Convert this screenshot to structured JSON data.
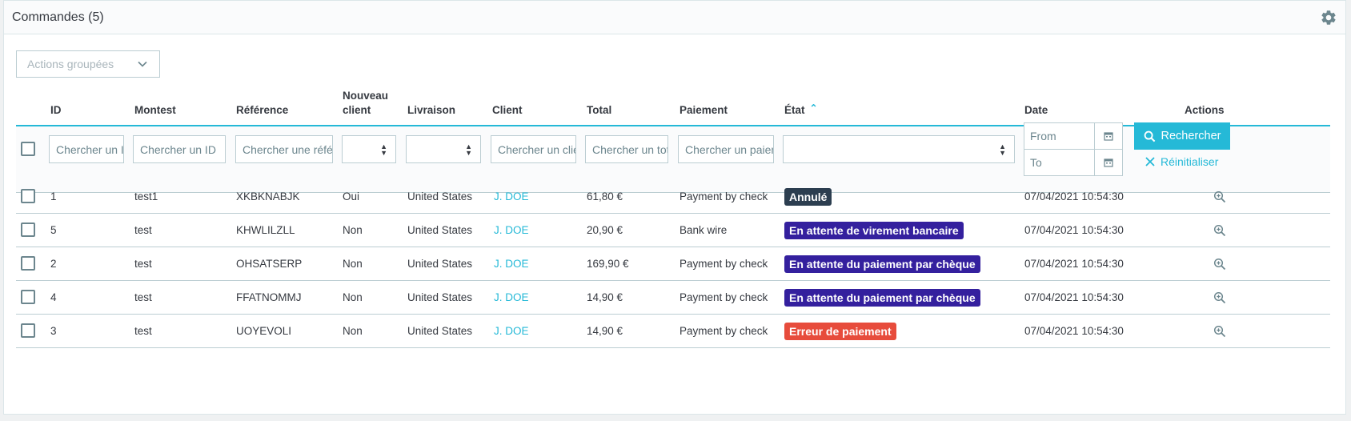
{
  "panel": {
    "title": "Commandes (5)"
  },
  "bulk_actions": {
    "label": "Actions groupées"
  },
  "columns": {
    "id": "ID",
    "montest": "Montest",
    "reference": "Référence",
    "new_client_line1": "Nouveau",
    "new_client_line2": "client",
    "delivery": "Livraison",
    "client": "Client",
    "total": "Total",
    "payment": "Paiement",
    "status": "État",
    "date": "Date",
    "actions": "Actions"
  },
  "filters": {
    "id_placeholder": "Chercher un ID",
    "montest_placeholder": "Chercher un ID",
    "reference_placeholder": "Chercher une référence",
    "client_placeholder": "Chercher un client",
    "total_placeholder": "Chercher un total",
    "payment_placeholder": "Chercher un paiement",
    "date_from": "From",
    "date_to": "To",
    "search_label": "Rechercher",
    "reset_label": "Réinitialiser"
  },
  "colors": {
    "accent": "#25b9d7",
    "status_cancelled": "#2c3e50",
    "status_awaiting": "#34209e",
    "status_error": "#e74c3c"
  },
  "rows": [
    {
      "id": "1",
      "montest": "test1",
      "reference": "XKBKNABJK",
      "new_client": "Oui",
      "delivery": "United States",
      "client": "J. DOE",
      "total": "61,80 €",
      "payment": "Payment by check",
      "status": "Annulé",
      "status_color": "#2c3e50",
      "date": "07/04/2021 10:54:30"
    },
    {
      "id": "5",
      "montest": "test",
      "reference": "KHWLILZLL",
      "new_client": "Non",
      "delivery": "United States",
      "client": "J. DOE",
      "total": "20,90 €",
      "payment": "Bank wire",
      "status": "En attente de virement bancaire",
      "status_color": "#34209e",
      "date": "07/04/2021 10:54:30"
    },
    {
      "id": "2",
      "montest": "test",
      "reference": "OHSATSERP",
      "new_client": "Non",
      "delivery": "United States",
      "client": "J. DOE",
      "total": "169,90 €",
      "payment": "Payment by check",
      "status": "En attente du paiement par chèque",
      "status_color": "#34209e",
      "date": "07/04/2021 10:54:30"
    },
    {
      "id": "4",
      "montest": "test",
      "reference": "FFATNOMMJ",
      "new_client": "Non",
      "delivery": "United States",
      "client": "J. DOE",
      "total": "14,90 €",
      "payment": "Payment by check",
      "status": "En attente du paiement par chèque",
      "status_color": "#34209e",
      "date": "07/04/2021 10:54:30"
    },
    {
      "id": "3",
      "montest": "test",
      "reference": "UOYEVOLI",
      "new_client": "Non",
      "delivery": "United States",
      "client": "J. DOE",
      "total": "14,90 €",
      "payment": "Payment by check",
      "status": "Erreur de paiement",
      "status_color": "#e74c3c",
      "date": "07/04/2021 10:54:30"
    }
  ]
}
